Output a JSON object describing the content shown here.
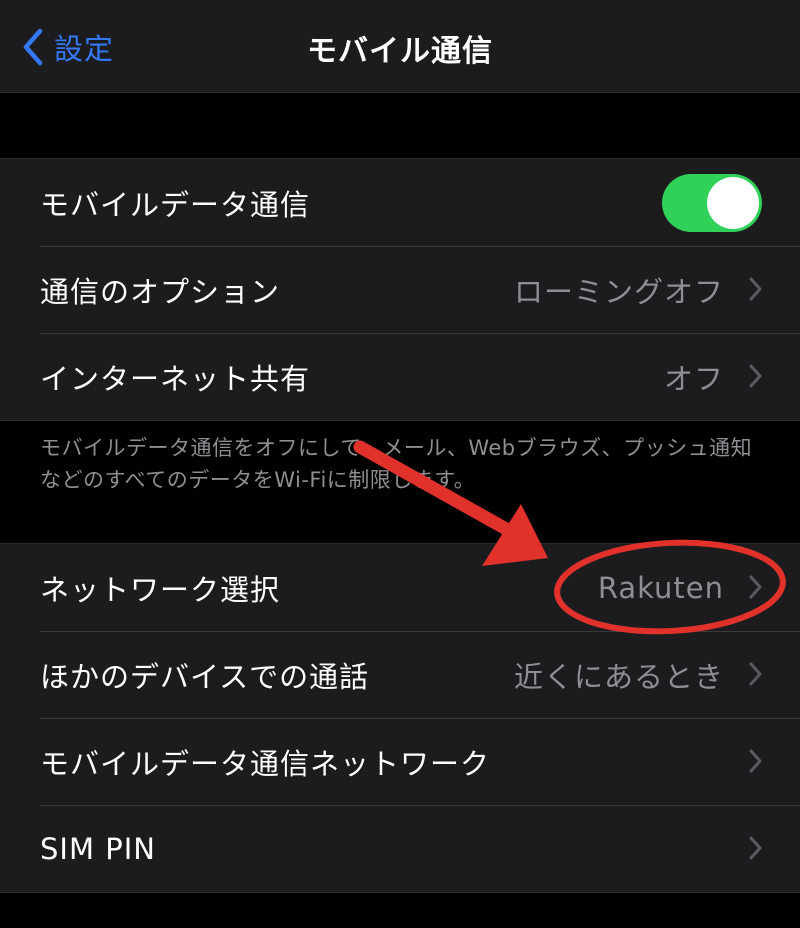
{
  "nav": {
    "back_label": "設定",
    "title": "モバイル通信"
  },
  "group1": {
    "mobile_data_label": "モバイルデータ通信",
    "mobile_data_on": true,
    "options_label": "通信のオプション",
    "options_value": "ローミングオフ",
    "hotspot_label": "インターネット共有",
    "hotspot_value": "オフ"
  },
  "footnote": "モバイルデータ通信をオフにして、メール、Webブラウズ、プッシュ通知などのすべてのデータをWi-Fiに制限します。",
  "group2": {
    "network_label": "ネットワーク選択",
    "network_value": "Rakuten",
    "calls_label": "ほかのデバイスでの通話",
    "calls_value": "近くにあるとき",
    "cellular_network_label": "モバイルデータ通信ネットワーク",
    "sim_pin_label": "SIM PIN"
  },
  "colors": {
    "accent": "#3478f6",
    "toggle_on": "#30d158",
    "annotation": "#e0322a",
    "background": "#000000",
    "cell": "#1c1c1e",
    "secondary_text": "#8e8e93"
  },
  "icons": [
    "back-chevron-icon",
    "chevron-right-icon",
    "arrow-annotation",
    "circle-annotation"
  ]
}
